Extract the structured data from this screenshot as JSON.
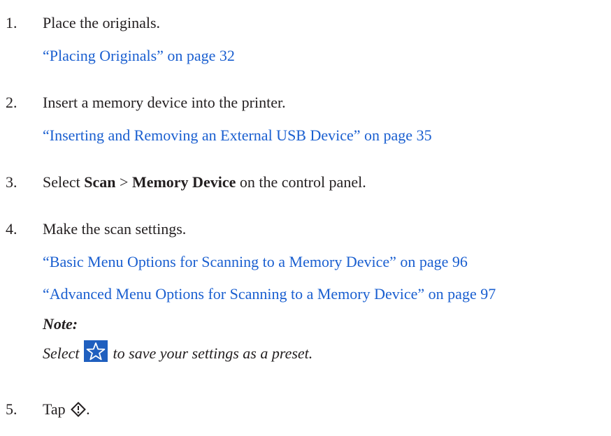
{
  "steps": [
    {
      "number": "1.",
      "text": "Place the originals.",
      "links": [
        "“Placing Originals” on page 32"
      ]
    },
    {
      "number": "2.",
      "text": "Insert a memory device into the printer.",
      "links": [
        "“Inserting and Removing an External USB Device” on page 35"
      ]
    },
    {
      "number": "3.",
      "text_prefix": "Select ",
      "bold1": "Scan",
      "separator": " > ",
      "bold2": "Memory Device",
      "text_suffix": " on the control panel."
    },
    {
      "number": "4.",
      "text": "Make the scan settings.",
      "links": [
        "“Basic Menu Options for Scanning to a Memory Device” on page 96",
        "“Advanced Menu Options for Scanning to a Memory Device” on page 97"
      ],
      "note_label": "Note:",
      "note_prefix": "Select ",
      "note_icon": "star-preset-icon",
      "note_suffix": " to save your settings as a preset."
    },
    {
      "number": "5.",
      "text": "Tap ",
      "icon": "start-diamond-icon",
      "text_suffix": "."
    }
  ],
  "colors": {
    "text": "#231f20",
    "link": "#1a5fd0",
    "icon_blue": "#1f5fbf"
  }
}
